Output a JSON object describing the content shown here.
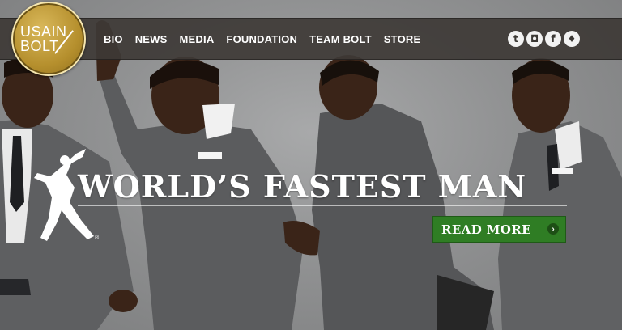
{
  "logo": {
    "line1": "USAIN",
    "line2": "BOLT"
  },
  "nav": {
    "items": [
      {
        "label": "BIO"
      },
      {
        "label": "NEWS"
      },
      {
        "label": "MEDIA"
      },
      {
        "label": "FOUNDATION"
      },
      {
        "label": "TEAM BOLT"
      },
      {
        "label": "STORE"
      }
    ]
  },
  "social": {
    "icons": [
      {
        "name": "tumblr-icon",
        "glyph": "t"
      },
      {
        "name": "instagram-icon",
        "glyph": "◘"
      },
      {
        "name": "facebook-icon",
        "glyph": "f"
      },
      {
        "name": "twitter-icon",
        "glyph": "♦"
      }
    ]
  },
  "hero": {
    "headline": "WORLD’S FASTEST MAN",
    "cta_label": "READ MORE",
    "cta_arrow": "›",
    "registered_mark": "®"
  },
  "colors": {
    "nav_bg": "#3e3a36",
    "logo_gold": "#b58f2d",
    "cta_green": "#2f7d24",
    "suit_gray": "#5e5f61",
    "skin": "#3a2418"
  }
}
